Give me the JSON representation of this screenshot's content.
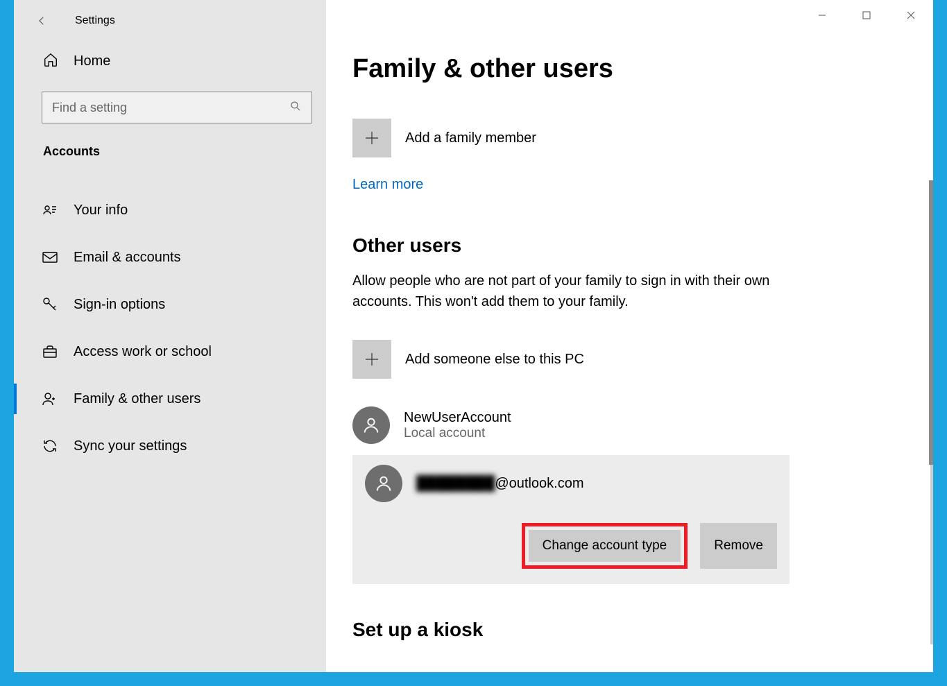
{
  "window": {
    "title": "Settings"
  },
  "sidebar": {
    "home_label": "Home",
    "search_placeholder": "Find a setting",
    "section_label": "Accounts",
    "items": [
      {
        "label": "Your info"
      },
      {
        "label": "Email & accounts"
      },
      {
        "label": "Sign-in options"
      },
      {
        "label": "Access work or school"
      },
      {
        "label": "Family & other users"
      },
      {
        "label": "Sync your settings"
      }
    ]
  },
  "content": {
    "page_title": "Family & other users",
    "add_family_label": "Add a family member",
    "learn_more": "Learn more",
    "other_users_heading": "Other users",
    "other_users_desc": "Allow people who are not part of your family to sign in with their own accounts. This won't add them to your family.",
    "add_someone_label": "Add someone else to this PC",
    "users": [
      {
        "name": "NewUserAccount",
        "subtitle": "Local account"
      },
      {
        "name_hidden": "████████",
        "name_suffix": "@outlook.com"
      }
    ],
    "change_account_type_label": "Change account type",
    "remove_label": "Remove",
    "kiosk_heading": "Set up a kiosk"
  }
}
